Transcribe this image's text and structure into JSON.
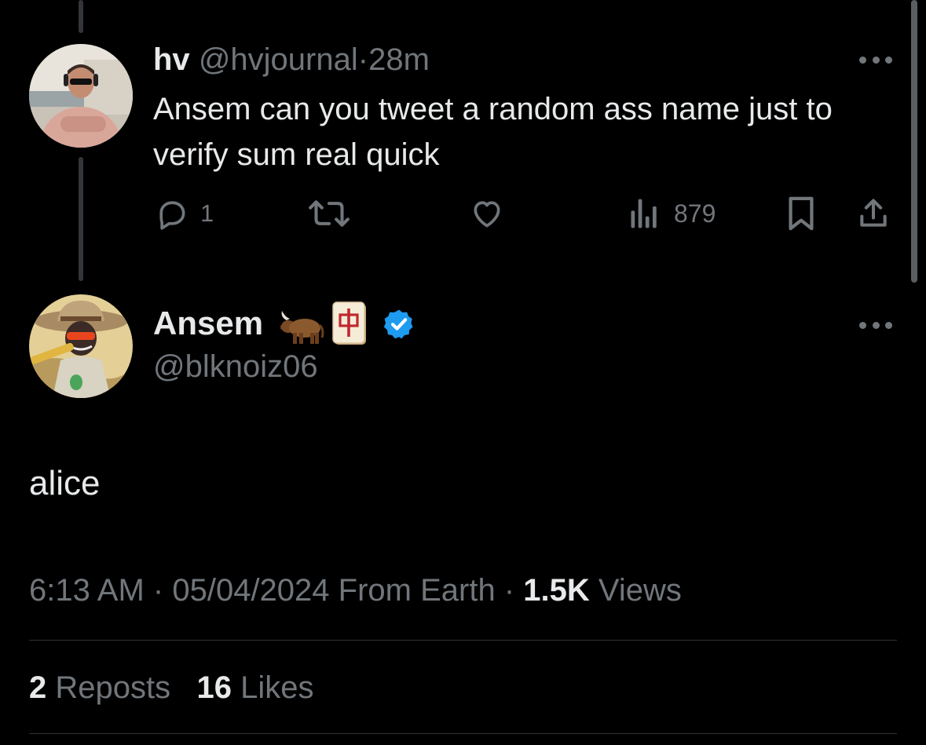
{
  "reply_tweet": {
    "display_name": "hv",
    "handle": "@hvjournal",
    "separator": "·",
    "time_ago": "28m",
    "text": "Ansem can you tweet a random ass name just to verify sum real quick",
    "actions": {
      "reply_count": "1",
      "views_count": "879"
    },
    "icons": [
      "reply-icon",
      "retweet-icon",
      "like-icon",
      "views-icon",
      "bookmark-icon",
      "share-icon",
      "more-icon"
    ]
  },
  "main_tweet": {
    "display_name": "Ansem",
    "name_emoji": [
      "ox",
      "mahjong-red-dragon"
    ],
    "verified": true,
    "verified_color": "#1d9bf0",
    "handle": "@blknoiz06",
    "text": "alice",
    "time": "6:13 AM",
    "separator": "·",
    "date": "05/04/2024",
    "from": "From Earth",
    "views_count": "1.5K",
    "views_label": "Views",
    "reposts_count": "2",
    "reposts_label": "Reposts",
    "likes_count": "16",
    "likes_label": "Likes"
  },
  "colors": {
    "background": "#000000",
    "text_primary": "#e7e9ea",
    "text_secondary": "#71767b",
    "divider": "#2f3336",
    "thread_line": "#333639"
  }
}
